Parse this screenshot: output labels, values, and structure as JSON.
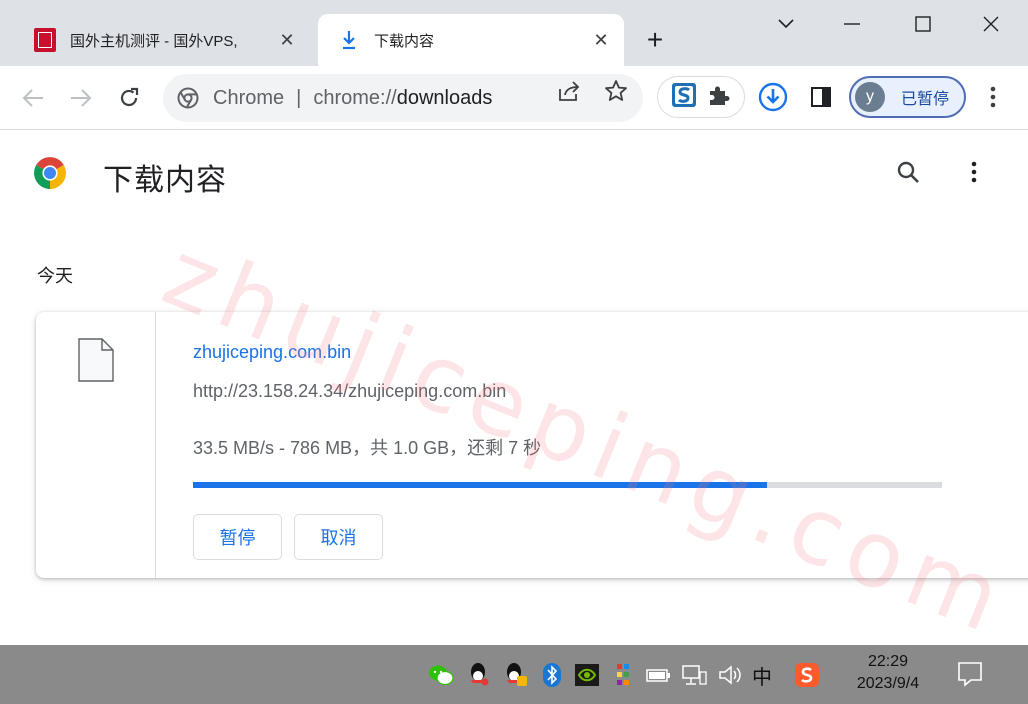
{
  "tabs": [
    {
      "title": "国外主机测评 - 国外VPS,",
      "active": false,
      "favicon": "seal-icon"
    },
    {
      "title": "下载内容",
      "active": true,
      "favicon": "download-icon"
    }
  ],
  "new_tab_label": "+",
  "omnibox": {
    "scheme": "Chrome",
    "url_prefix": "chrome://",
    "url_host": "downloads"
  },
  "profile": {
    "initial": "y",
    "label": "已暂停"
  },
  "page": {
    "title": "下载内容",
    "section": "今天"
  },
  "download": {
    "filename": "zhujiceping.com.bin",
    "url": "http://23.158.24.34/zhujiceping.com.bin",
    "status": "33.5 MB/s - 786 MB，共 1.0 GB，还剩 7 秒",
    "progress_percent": 76.7,
    "pause_label": "暂停",
    "cancel_label": "取消"
  },
  "watermark": "zhujiceping.com",
  "taskbar": {
    "ime": "中",
    "time": "22:29",
    "date": "2023/9/4"
  },
  "colors": {
    "accent": "#1a73e8",
    "tabstrip": "#dee1e6",
    "taskbar": "#8a8a8a"
  }
}
